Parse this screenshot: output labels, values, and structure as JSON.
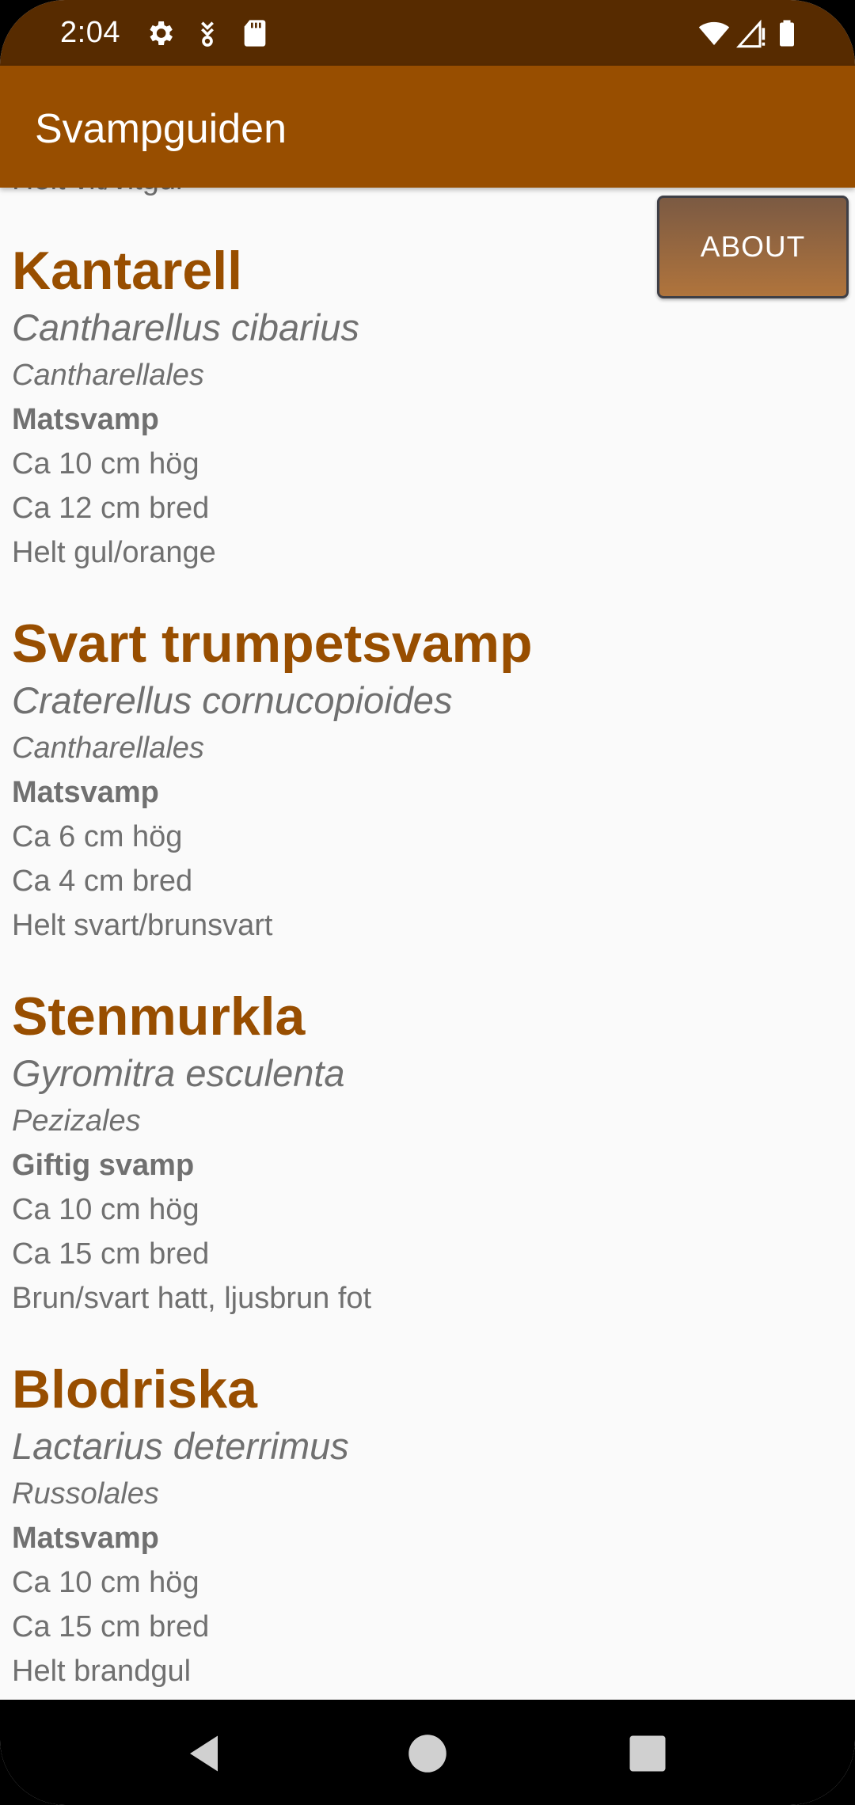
{
  "status_bar": {
    "time": "2:04",
    "icons": [
      "settings-icon",
      "download-icon",
      "sd-card-icon",
      "wifi-icon",
      "signal-icon",
      "battery-icon"
    ]
  },
  "app_bar": {
    "title": "Svampguiden"
  },
  "about_button": {
    "label": "ABOUT"
  },
  "partial_item": {
    "color": "Helt vit/vitgul"
  },
  "mushrooms": [
    {
      "name": "Kantarell",
      "latin": "Cantharellus cibarius",
      "order": "Cantharellales",
      "type": "Matsvamp",
      "height": "Ca 10 cm hög",
      "width": "Ca 12 cm bred",
      "color": "Helt gul/orange"
    },
    {
      "name": "Svart trumpetsvamp",
      "latin": "Craterellus cornucopioides",
      "order": "Cantharellales",
      "type": "Matsvamp",
      "height": "Ca 6 cm hög",
      "width": "Ca 4 cm bred",
      "color": "Helt svart/brunsvart"
    },
    {
      "name": "Stenmurkla",
      "latin": "Gyromitra esculenta",
      "order": "Pezizales",
      "type": "Giftig svamp",
      "height": "Ca 10 cm hög",
      "width": "Ca 15 cm bred",
      "color": "Brun/svart hatt, ljusbrun fot"
    },
    {
      "name": "Blodriska",
      "latin": "Lactarius deterrimus",
      "order": "Russolales",
      "type": "Matsvamp",
      "height": "Ca 10 cm hög",
      "width": "Ca 15 cm bred",
      "color": "Helt brandgul"
    }
  ],
  "nav_bar": {
    "buttons": [
      "back-icon",
      "home-icon",
      "recents-icon"
    ]
  },
  "colors": {
    "status_bar": "#572b00",
    "app_bar": "#984e00",
    "title_text": "#984e00",
    "body_text": "#707070",
    "background": "#fafafa"
  }
}
